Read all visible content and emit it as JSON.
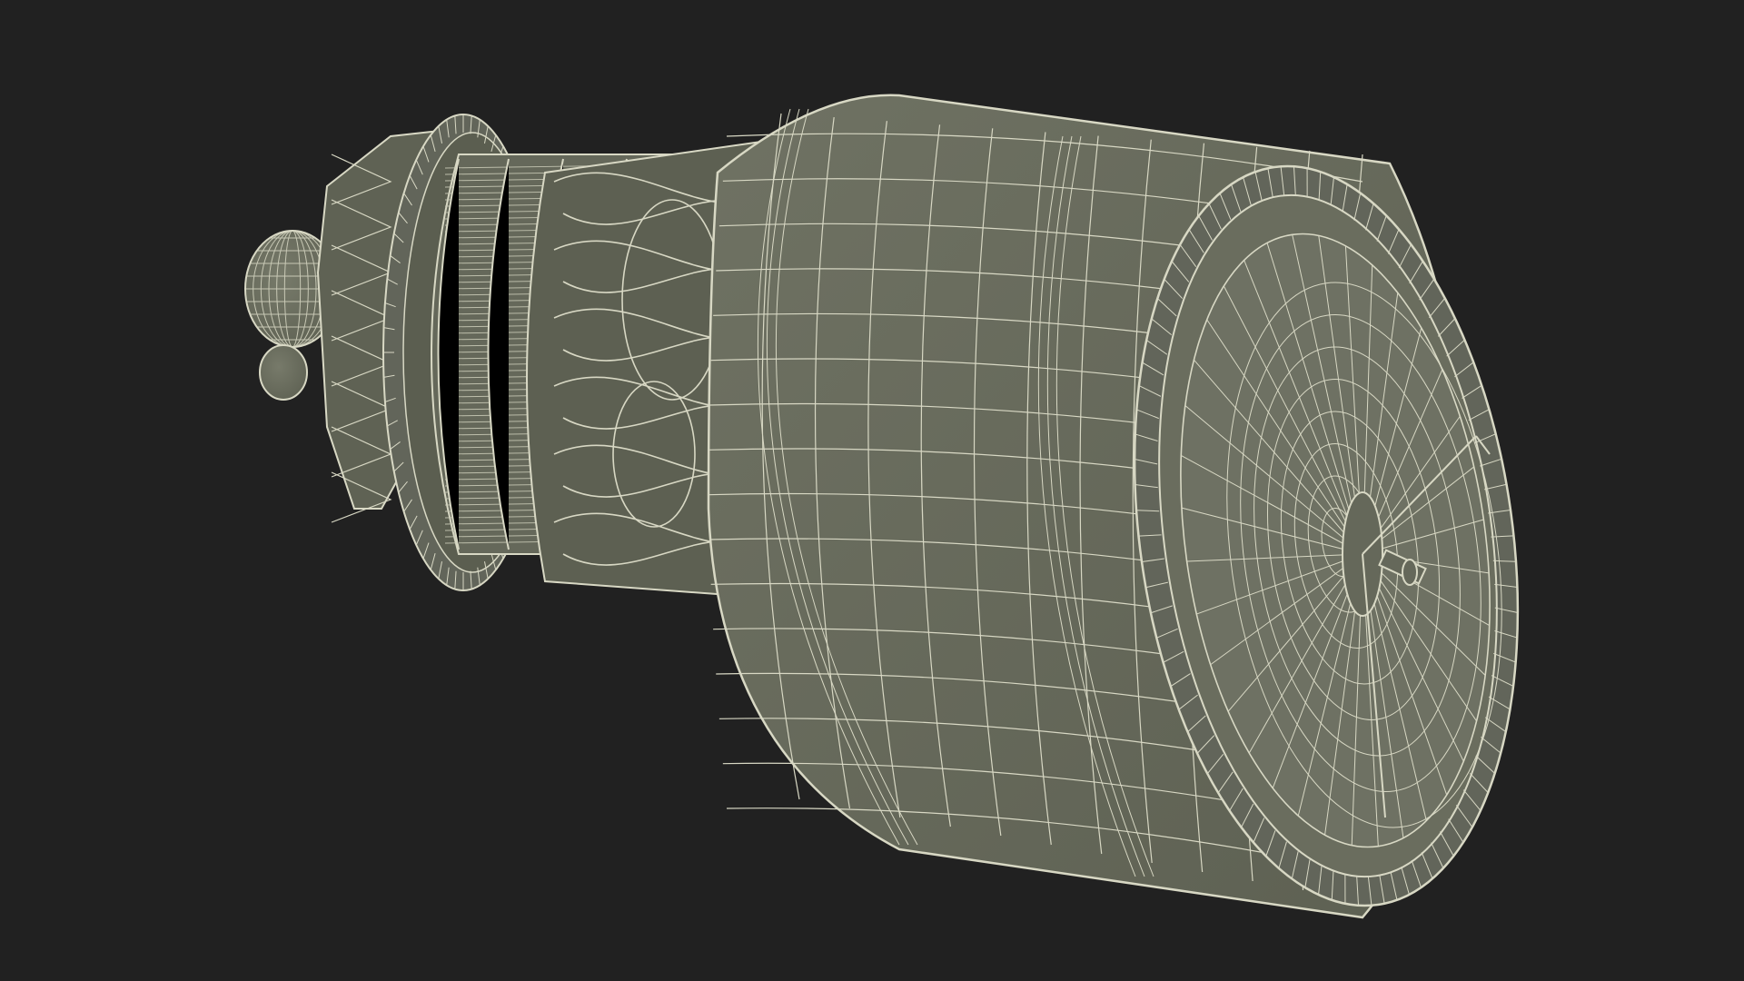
{
  "viewport": {
    "background": "#212121",
    "subject": "wireframe-satellite-telescope"
  },
  "colors": {
    "surface": "#686b5c",
    "surface_dark": "#5b5e50",
    "surface_light": "#777a6a",
    "wire": "#d8d8c4",
    "wire_dim": "#b6b7a3"
  }
}
